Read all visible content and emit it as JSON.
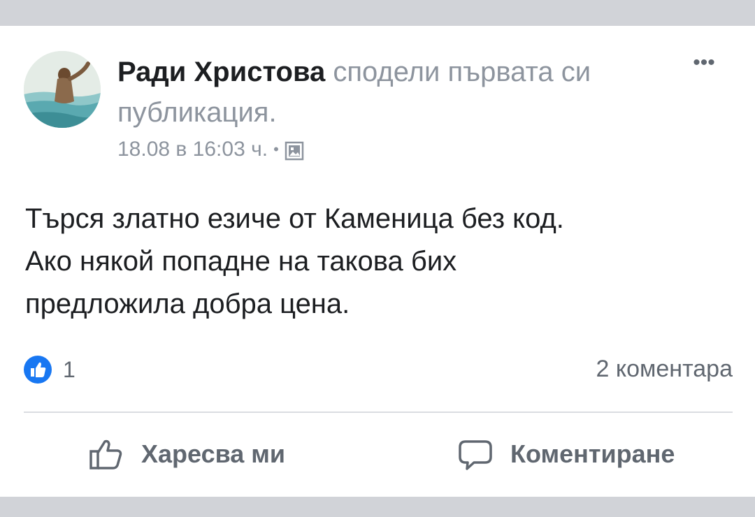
{
  "post": {
    "author": "Ради Христова",
    "action": "сподели първата си публикация.",
    "timestamp": "18.08 в 16:03 ч.",
    "separator": "•",
    "privacy_icon": "album-icon",
    "more_label": "•••",
    "text_lines": [
      "Търся златно езиче от Каменица без код.",
      "Ако някой попадне на такова бих",
      "предложила добра цена."
    ]
  },
  "reactions": {
    "like_icon": "thumbs-up-icon",
    "count": "1",
    "comments": "2 коментара"
  },
  "actions": {
    "like_label": "Харесва ми",
    "comment_label": "Коментиране"
  },
  "colors": {
    "band": "#d1d3d8",
    "accent": "#1877f2",
    "secondary_text": "#606770"
  }
}
